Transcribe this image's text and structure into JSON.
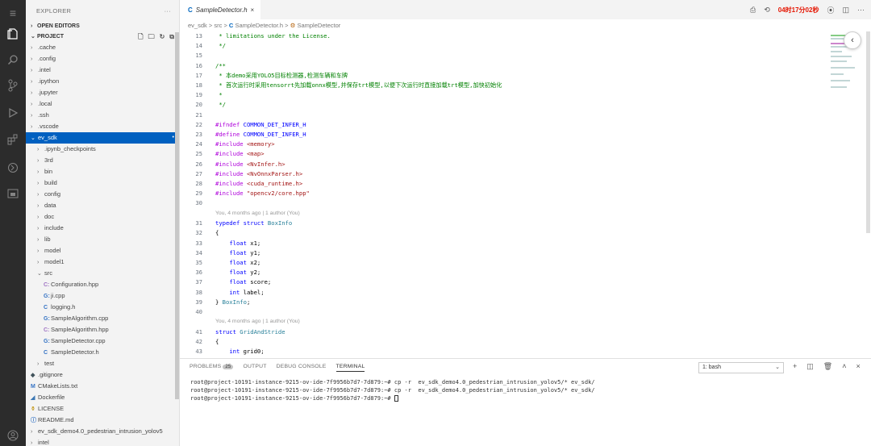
{
  "activity_bar": {
    "icons": [
      "menu-icon",
      "files-icon",
      "search-icon",
      "source-control-icon",
      "run-debug-icon",
      "extensions-icon",
      "remote-icon",
      "panel-icon",
      "account-icon"
    ]
  },
  "sidebar": {
    "title": "EXPLORER",
    "more": "···",
    "open_editors": "OPEN EDITORS",
    "project": "PROJECT",
    "items": [
      {
        "label": ".cache",
        "indent": 1,
        "type": "folder",
        "open": false
      },
      {
        "label": ".config",
        "indent": 1,
        "type": "folder",
        "open": false
      },
      {
        "label": ".intel",
        "indent": 1,
        "type": "folder",
        "open": false
      },
      {
        "label": ".ipython",
        "indent": 1,
        "type": "folder",
        "open": false
      },
      {
        "label": ".jupyter",
        "indent": 1,
        "type": "folder",
        "open": false
      },
      {
        "label": ".local",
        "indent": 1,
        "type": "folder",
        "open": false
      },
      {
        "label": ".ssh",
        "indent": 1,
        "type": "folder",
        "open": false
      },
      {
        "label": ".vscode",
        "indent": 1,
        "type": "folder",
        "open": false
      },
      {
        "label": "ev_sdk",
        "indent": 1,
        "type": "folder",
        "open": true,
        "selected": true
      },
      {
        "label": ".ipynb_checkpoints",
        "indent": 2,
        "type": "folder",
        "open": false
      },
      {
        "label": "3rd",
        "indent": 2,
        "type": "folder",
        "open": false
      },
      {
        "label": "bin",
        "indent": 2,
        "type": "folder",
        "open": false
      },
      {
        "label": "build",
        "indent": 2,
        "type": "folder",
        "open": false
      },
      {
        "label": "config",
        "indent": 2,
        "type": "folder",
        "open": false
      },
      {
        "label": "data",
        "indent": 2,
        "type": "folder",
        "open": false
      },
      {
        "label": "doc",
        "indent": 2,
        "type": "folder",
        "open": false
      },
      {
        "label": "include",
        "indent": 2,
        "type": "folder",
        "open": false
      },
      {
        "label": "lib",
        "indent": 2,
        "type": "folder",
        "open": false
      },
      {
        "label": "model",
        "indent": 2,
        "type": "folder",
        "open": false
      },
      {
        "label": "model1",
        "indent": 2,
        "type": "folder",
        "open": false
      },
      {
        "label": "src",
        "indent": 2,
        "type": "folder",
        "open": true
      },
      {
        "label": "Configuration.hpp",
        "indent": 3,
        "type": "file",
        "icon": "C:",
        "color": "#a074c4"
      },
      {
        "label": "ji.cpp",
        "indent": 3,
        "type": "file",
        "icon": "G:",
        "color": "#3573c4"
      },
      {
        "label": "logging.h",
        "indent": 3,
        "type": "file",
        "icon": "C",
        "color": "#3573c4"
      },
      {
        "label": "SampleAlgorithm.cpp",
        "indent": 3,
        "type": "file",
        "icon": "G:",
        "color": "#3573c4"
      },
      {
        "label": "SampleAlgorithm.hpp",
        "indent": 3,
        "type": "file",
        "icon": "C:",
        "color": "#a074c4"
      },
      {
        "label": "SampleDetector.cpp",
        "indent": 3,
        "type": "file",
        "icon": "G:",
        "color": "#3573c4"
      },
      {
        "label": "SampleDetector.h",
        "indent": 3,
        "type": "file",
        "icon": "C",
        "color": "#3573c4"
      },
      {
        "label": "test",
        "indent": 2,
        "type": "folder",
        "open": false
      },
      {
        "label": ".gitignore",
        "indent": 1,
        "type": "file",
        "icon": "◆",
        "color": "#41535b"
      },
      {
        "label": "CMakeLists.txt",
        "indent": 1,
        "type": "file",
        "icon": "M",
        "color": "#3573c4"
      },
      {
        "label": "Dockerfile",
        "indent": 1,
        "type": "file",
        "icon": "◢",
        "color": "#3c78b4"
      },
      {
        "label": "LICENSE",
        "indent": 1,
        "type": "file",
        "icon": "⚱",
        "color": "#c7a02c"
      },
      {
        "label": "README.md",
        "indent": 1,
        "type": "file",
        "icon": "ⓘ",
        "color": "#3573c4"
      },
      {
        "label": "ev_sdk_demo4.0_pedestrian_intrusion_yolov5",
        "indent": 1,
        "type": "folder",
        "open": false
      },
      {
        "label": "intel",
        "indent": 1,
        "type": "folder",
        "open": false
      }
    ]
  },
  "tab": {
    "icon": "C",
    "label": "SampleDetector.h",
    "close": "×"
  },
  "topbar": {
    "timer": "04时17分02秒"
  },
  "breadcrumb": {
    "p1": "ev_sdk",
    "sep": ">",
    "p2": "src",
    "p3": "SampleDetector.h",
    "p4": "SampleDetector"
  },
  "editor": {
    "lines": [
      {
        "n": "13",
        "html": "<span class=\"cm\"> * limitations under the License.</span>"
      },
      {
        "n": "14",
        "html": "<span class=\"cm\"> */</span>"
      },
      {
        "n": "15",
        "html": ""
      },
      {
        "n": "16",
        "html": "<span class=\"cm\">/**</span>"
      },
      {
        "n": "17",
        "html": "<span class=\"cm\"> * 本demo采用YOLO5目标检测器,检测车辆和车牌</span>"
      },
      {
        "n": "18",
        "html": "<span class=\"cm\"> * 首次运行时采用tensorrt先加载onnx模型,并保存trt模型,以便下次运行时直接加载trt模型,加快初始化</span>"
      },
      {
        "n": "19",
        "html": "<span class=\"cm\"> *</span>"
      },
      {
        "n": "20",
        "html": "<span class=\"cm\"> */</span>"
      },
      {
        "n": "21",
        "html": ""
      },
      {
        "n": "22",
        "html": "<span class=\"pp\">#ifndef</span> <span class=\"kw\">COMMON_DET_INFER_H</span>"
      },
      {
        "n": "23",
        "html": "<span class=\"pp\">#define</span> <span class=\"kw\">COMMON_DET_INFER_H</span>"
      },
      {
        "n": "24",
        "html": "<span class=\"pp\">#include</span> <span class=\"st\">&lt;memory&gt;</span>"
      },
      {
        "n": "25",
        "html": "<span class=\"pp\">#include</span> <span class=\"st\">&lt;map&gt;</span>"
      },
      {
        "n": "26",
        "html": "<span class=\"pp\">#include</span> <span class=\"st\">&lt;NvInfer.h&gt;</span>"
      },
      {
        "n": "27",
        "html": "<span class=\"pp\">#include</span> <span class=\"st\">&lt;NvOnnxParser.h&gt;</span>"
      },
      {
        "n": "28",
        "html": "<span class=\"pp\">#include</span> <span class=\"st\">&lt;cuda_runtime.h&gt;</span>"
      },
      {
        "n": "29",
        "html": "<span class=\"pp\">#include</span> <span class=\"st\">\"opencv2/core.hpp\"</span>"
      },
      {
        "n": "30",
        "html": ""
      },
      {
        "lens": "You, 4 months ago | 1 author (You)"
      },
      {
        "n": "31",
        "html": "<span class=\"kw\">typedef</span> <span class=\"kw\">struct</span> <span class=\"ty\">BoxInfo</span>"
      },
      {
        "n": "32",
        "html": "{"
      },
      {
        "n": "33",
        "html": "    <span class=\"kw\">float</span> x1;"
      },
      {
        "n": "34",
        "html": "    <span class=\"kw\">float</span> y1;"
      },
      {
        "n": "35",
        "html": "    <span class=\"kw\">float</span> x2;"
      },
      {
        "n": "36",
        "html": "    <span class=\"kw\">float</span> y2;"
      },
      {
        "n": "37",
        "html": "    <span class=\"kw\">float</span> score;"
      },
      {
        "n": "38",
        "html": "    <span class=\"kw\">int</span> label;"
      },
      {
        "n": "39",
        "html": "} <span class=\"ty\">BoxInfo</span>;"
      },
      {
        "n": "40",
        "html": ""
      },
      {
        "lens": "You, 4 months ago | 1 author (You)"
      },
      {
        "n": "41",
        "html": "<span class=\"kw\">struct</span> <span class=\"ty\">GridAndStride</span>"
      },
      {
        "n": "42",
        "html": "{"
      },
      {
        "n": "43",
        "html": "    <span class=\"kw\">int</span> grid0;"
      },
      {
        "n": "44",
        "html": "    <span class=\"kw\">int</span> grid1;"
      }
    ]
  },
  "panel": {
    "tabs": [
      {
        "label": "PROBLEMS",
        "badge": "25",
        "active": false
      },
      {
        "label": "OUTPUT",
        "active": false
      },
      {
        "label": "DEBUG CONSOLE",
        "active": false
      },
      {
        "label": "TERMINAL",
        "active": true
      }
    ],
    "shell": "1: bash",
    "terminal": [
      "root@project-10191-instance-9215-ov-ide-7f9956b7d7-7d879:~# cp -r  ev_sdk_demo4.0_pedestrian_intrusion_yolov5/* ev_sdk/",
      "root@project-10191-instance-9215-ov-ide-7f9956b7d7-7d879:~# cp -r  ev_sdk_demo4.0_pedestrian_intrusion_yolov5/* ev_sdk/",
      "root@project-10191-instance-9215-ov-ide-7f9956b7d7-7d879:~# "
    ]
  }
}
